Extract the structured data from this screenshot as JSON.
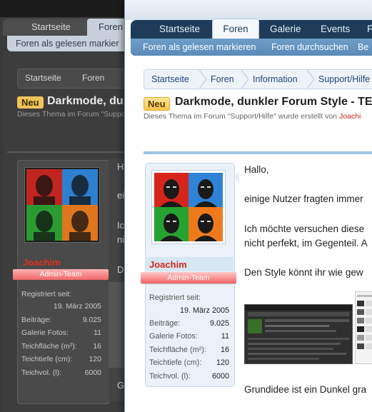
{
  "dark": {
    "nav": {
      "tab1": "Startseite",
      "tab2": "Foren"
    },
    "subbar": "Foren als gelesen markier",
    "breadcrumb": [
      "Startseite",
      "Foren"
    ],
    "badge": "Neu",
    "title": "Darkmode, dunk",
    "subtitle": "Dieses Thema im Forum \"Suppor",
    "user": {
      "name": "Joachim",
      "role": "Admin-Team",
      "stats": [
        {
          "k": "Registriert seit:",
          "v": "19. März 2005"
        },
        {
          "k": "Beiträge:",
          "v": "9.025"
        },
        {
          "k": "Galerie Fotos:",
          "v": "11"
        },
        {
          "k": "Teichfläche (m²):",
          "v": "16"
        },
        {
          "k": "Teichtiefe (cm):",
          "v": "120"
        },
        {
          "k": "Teichvol. (l):",
          "v": "6000"
        }
      ]
    },
    "message_fragments": [
      "Ha",
      "ei",
      "Ic",
      "ni",
      "De",
      "G"
    ]
  },
  "light": {
    "nav": {
      "items": [
        "Startseite",
        "Foren",
        "Galerie",
        "Events",
        "F"
      ],
      "active_index": 1
    },
    "subnav": [
      "Foren als gelesen markieren",
      "Foren durchsuchen",
      "Be"
    ],
    "breadcrumb": [
      "Startseite",
      "Foren",
      "Information",
      "Support/Hilfe"
    ],
    "badge": "Neu",
    "title": "Darkmode, dunkler Forum Style - TE",
    "subtitle_pre": "Dieses Thema im Forum \"Support/Hilfe\" wurde erstellt von ",
    "subtitle_author": "Joachi",
    "user": {
      "name": "Joachim",
      "role": "Admin-Team",
      "registered_label": "Registriert seit:",
      "registered_value": "19. März 2005",
      "stats": [
        {
          "k": "Beiträge:",
          "v": "9.025"
        },
        {
          "k": "Galerie Fotos:",
          "v": "11"
        },
        {
          "k": "Teichfläche (m²):",
          "v": "16"
        },
        {
          "k": "Teichtiefe (cm):",
          "v": "120"
        },
        {
          "k": "Teichvol. (l):",
          "v": "6000"
        }
      ]
    },
    "message": {
      "line1": "Hallo,",
      "line2": "einige Nutzer fragten immer",
      "line3": "Ich möchte versuchen diese",
      "line4": "nicht perfekt, im Gegenteil. A",
      "line5": "Den Style könnt ihr wie gew",
      "line6": "Grundidee ist ein Dunkel gra"
    }
  },
  "colors": {
    "nav_dark_blue": "#1e3c5a",
    "subnav_blue": "#5b8bb6",
    "username_red": "#d0281c",
    "badge_yellow": "#f7c64a",
    "rule_blue": "#9dc3e2"
  }
}
